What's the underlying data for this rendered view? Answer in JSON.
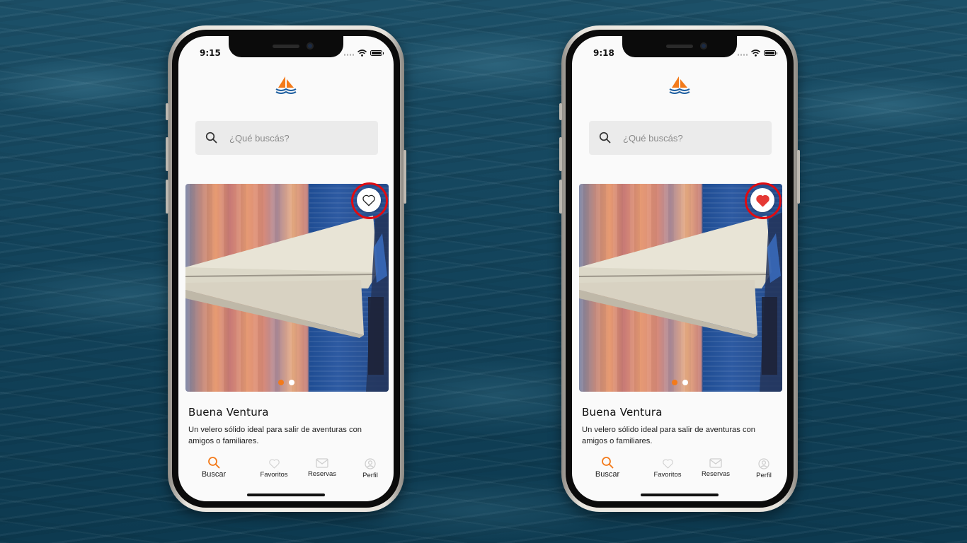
{
  "colors": {
    "accent": "#f37a1a",
    "highlight_ring": "#e10b10",
    "heart_filled": "#e53935",
    "search_bg": "#ebebeb",
    "screen_bg": "#fafafa"
  },
  "phones": [
    {
      "state": "not-favorited",
      "status_bar": {
        "time": "9:15"
      },
      "app_logo_icon": "sailboat-logo-icon",
      "search": {
        "icon": "search-icon",
        "placeholder": "¿Qué buscás?"
      },
      "card": {
        "image_icon": "sailboat-photo",
        "favorite_icon": "heart-outline-icon",
        "favorited": false,
        "carousel": {
          "pages": 2,
          "active": 1
        },
        "title": "Buena Ventura",
        "description": "Un velero sólido ideal para salir de aventuras con amigos o familiares."
      },
      "tabs": [
        {
          "label": "Buscar",
          "icon": "search-icon",
          "active": true
        },
        {
          "label": "Favoritos",
          "icon": "heart-icon",
          "active": false
        },
        {
          "label": "Reservas",
          "icon": "envelope-icon",
          "active": false
        },
        {
          "label": "Perfil",
          "icon": "user-icon",
          "active": false
        }
      ]
    },
    {
      "state": "favorited",
      "status_bar": {
        "time": "9:18"
      },
      "app_logo_icon": "sailboat-logo-icon",
      "search": {
        "icon": "search-icon",
        "placeholder": "¿Qué buscás?"
      },
      "card": {
        "image_icon": "sailboat-photo",
        "favorite_icon": "heart-filled-icon",
        "favorited": true,
        "carousel": {
          "pages": 2,
          "active": 1
        },
        "title": "Buena Ventura",
        "description": "Un velero sólido ideal para salir de aventuras con amigos o familiares."
      },
      "tabs": [
        {
          "label": "Buscar",
          "icon": "search-icon",
          "active": true
        },
        {
          "label": "Favoritos",
          "icon": "heart-icon",
          "active": false
        },
        {
          "label": "Reservas",
          "icon": "envelope-icon",
          "active": false
        },
        {
          "label": "Perfil",
          "icon": "user-icon",
          "active": false
        }
      ]
    }
  ]
}
